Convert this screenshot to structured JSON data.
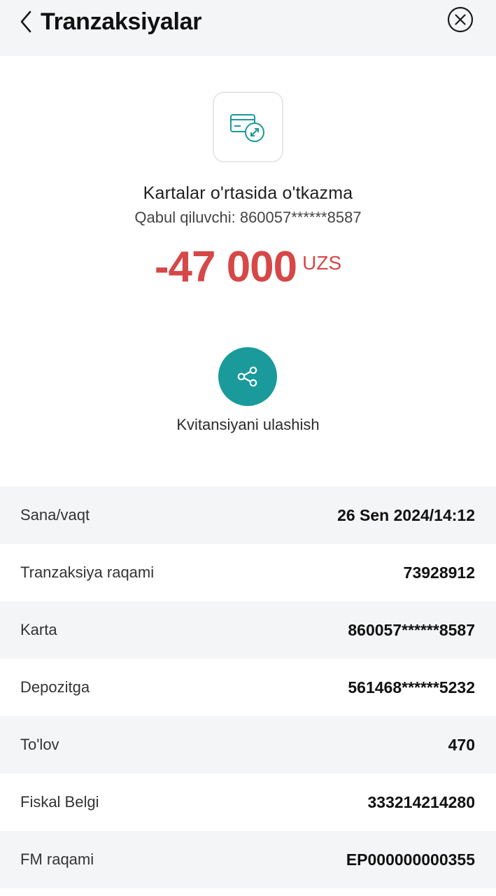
{
  "header": {
    "title": "Tranzaksiyalar",
    "back_icon": "chevron-left-icon",
    "close_icon": "close-circle-icon"
  },
  "transaction": {
    "icon": "card-transfer-icon",
    "title": "Kartalar o'rtasida o'tkazma",
    "receiver": "Qabul qiluvchi: 860057******8587",
    "amount": "-47 000",
    "currency": "UZS"
  },
  "share": {
    "icon": "share-icon",
    "label": "Kvitansiyani ulashish"
  },
  "details": [
    {
      "label": "Sana/vaqt",
      "value": "26 Sen 2024/14:12"
    },
    {
      "label": "Tranzaksiya raqami",
      "value": "73928912"
    },
    {
      "label": "Karta",
      "value": "860057******8587"
    },
    {
      "label": "Depozitga",
      "value": "561468******5232"
    },
    {
      "label": "To'lov",
      "value": "470"
    },
    {
      "label": "Fiskal Belgi",
      "value": "333214214280"
    },
    {
      "label": "FM raqami",
      "value": "EP000000000355"
    }
  ],
  "colors": {
    "accent": "#1a9a9b",
    "amount_red": "#d64747",
    "row_shade": "#f4f5f7"
  }
}
